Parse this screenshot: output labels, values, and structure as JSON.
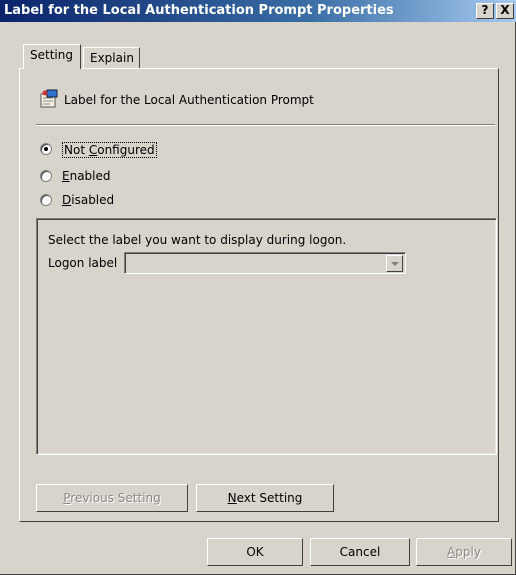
{
  "window": {
    "title": "Label for the Local Authentication Prompt Properties",
    "help_label": "?",
    "close_label": "X"
  },
  "tabs": [
    {
      "label": "Setting",
      "active": true
    },
    {
      "label": "Explain",
      "active": false
    }
  ],
  "policy": {
    "icon": "policy-setting-icon",
    "name": "Label for the Local Authentication Prompt"
  },
  "options": [
    {
      "label": "Not Configured",
      "mnemonic": "C",
      "selected": true
    },
    {
      "label": "Enabled",
      "mnemonic": "E",
      "selected": false
    },
    {
      "label": "Disabled",
      "mnemonic": "D",
      "selected": false
    }
  ],
  "settings_group": {
    "description": "Select the label you want to display during logon.",
    "logon_label": "Logon label",
    "logon_value": ""
  },
  "buttons": {
    "previous": "Previous Setting",
    "next": "Next Setting",
    "ok": "OK",
    "cancel": "Cancel",
    "apply": "Apply"
  },
  "colors": {
    "title_bar_start": "#0a246a",
    "title_bar_end": "#a6caf0",
    "dialog_face": "#d8d4cc"
  }
}
